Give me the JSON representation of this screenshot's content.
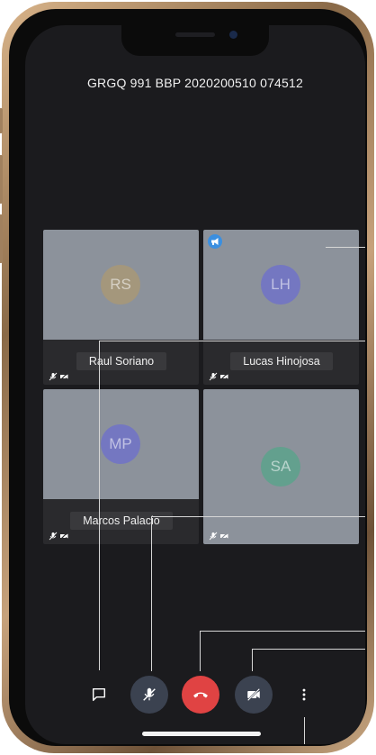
{
  "meeting": {
    "title": "GRGQ 991 BBP 2020200510 074512"
  },
  "participants": [
    {
      "initials": "RS",
      "name": "Raul Soriano",
      "avatar_color": "#a4977c"
    },
    {
      "initials": "LH",
      "name": "Lucas Hinojosa",
      "avatar_color": "#7477c1"
    },
    {
      "initials": "MP",
      "name": "Marcos Palacio",
      "avatar_color": "#7477c1"
    },
    {
      "initials": "SA",
      "name": "",
      "avatar_color": "#63a08e"
    }
  ],
  "controls": {
    "chat": "chat-icon",
    "mic": "mic-off-icon",
    "hangup": "hangup-icon",
    "camera": "camera-off-icon",
    "more": "more-vertical-icon",
    "button_color": "#3b4250",
    "hangup_color": "#e04343"
  }
}
